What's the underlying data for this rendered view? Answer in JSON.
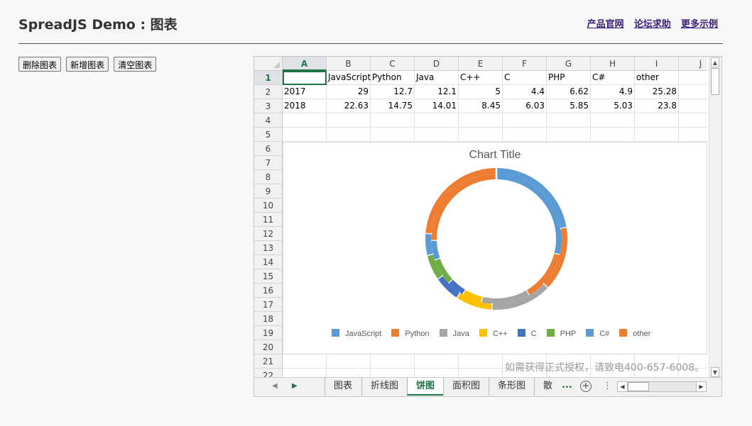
{
  "header": {
    "title": "SpreadJS Demo : 图表",
    "links": [
      "产品官网",
      "论坛求助",
      "更多示例"
    ]
  },
  "toolbar": {
    "delete_label": "删除图表",
    "add_label": "新增图表",
    "clear_label": "清空图表"
  },
  "sheet": {
    "columns": [
      "A",
      "B",
      "C",
      "D",
      "E",
      "F",
      "G",
      "H",
      "I",
      "J"
    ],
    "rows": [
      "1",
      "2",
      "3",
      "4",
      "5",
      "6",
      "7",
      "8",
      "9",
      "10",
      "11",
      "12",
      "13",
      "14",
      "15",
      "16",
      "17",
      "18",
      "19",
      "20",
      "21",
      "22"
    ],
    "active_cell": "A1",
    "cells": [
      [
        "",
        "JavaScript",
        "Python",
        "Java",
        "C++",
        "C",
        "PHP",
        "C#",
        "other"
      ],
      [
        "2017",
        "29",
        "12.7",
        "12.1",
        "5",
        "4.4",
        "6.62",
        "4.9",
        "25.28"
      ],
      [
        "2018",
        "22.63",
        "14.75",
        "14.01",
        "8.45",
        "6.03",
        "5.85",
        "5.03",
        "23.8"
      ]
    ]
  },
  "chart_data": {
    "type": "pie",
    "variant": "doughnut",
    "title": "Chart Title",
    "categories": [
      "JavaScript",
      "Python",
      "Java",
      "C++",
      "C",
      "PHP",
      "C#",
      "other"
    ],
    "series": [
      {
        "name": "2017",
        "values": [
          29,
          12.7,
          12.1,
          5,
          4.4,
          6.62,
          4.9,
          25.28
        ]
      },
      {
        "name": "2018",
        "values": [
          22.63,
          14.75,
          14.01,
          8.45,
          6.03,
          5.85,
          5.03,
          23.8
        ]
      }
    ],
    "colors": [
      "#5b9bd5",
      "#ed7d31",
      "#a5a5a5",
      "#ffc000",
      "#4472c4",
      "#70ad47",
      "#5b9bd5",
      "#ed7d31"
    ],
    "legend_position": "bottom"
  },
  "watermark": "如需获得正式授权，请致电400-657-6008。",
  "tabs": {
    "items": [
      "图表",
      "折线图",
      "饼图",
      "面积图",
      "条形图",
      "散点"
    ],
    "active": "饼图",
    "more": "..."
  }
}
